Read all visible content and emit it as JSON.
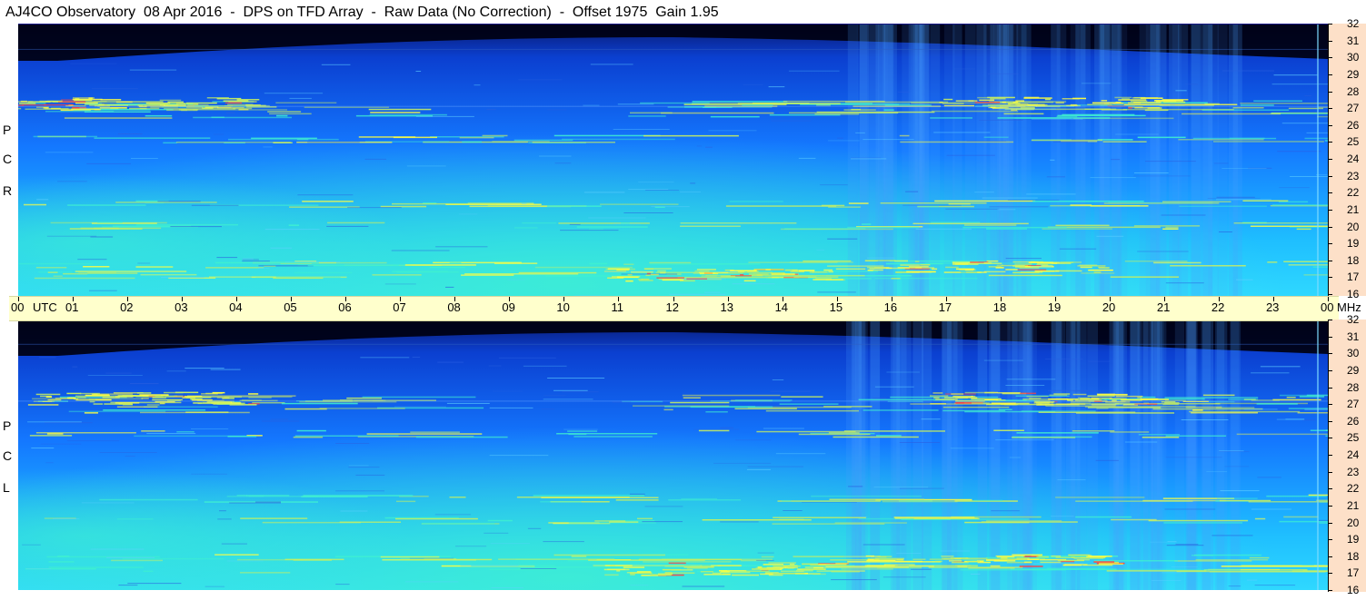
{
  "title": "AJ4CO Observatory  08 Apr 2016  -  DPS on TFD Array  -  Raw Data (No Correction)  -  Offset 1975  Gain 1.95",
  "chart_data": {
    "type": "heatmap",
    "x_axis": {
      "unit": "UTC",
      "range": [
        0,
        24
      ],
      "tick_labels": [
        "00",
        "01",
        "02",
        "03",
        "04",
        "05",
        "06",
        "07",
        "08",
        "09",
        "10",
        "11",
        "12",
        "13",
        "14",
        "15",
        "16",
        "17",
        "18",
        "19",
        "20",
        "21",
        "22",
        "23",
        "00"
      ]
    },
    "y_axis": {
      "unit": "MHz",
      "range": [
        16,
        32
      ],
      "tick_labels": [
        "32",
        "31",
        "30",
        "29",
        "28",
        "27",
        "26",
        "25",
        "24",
        "23",
        "22",
        "21",
        "20",
        "19",
        "18",
        "17",
        "16"
      ]
    },
    "panels": [
      {
        "label_letters": [
          "P",
          "C",
          "R"
        ]
      },
      {
        "label_letters": [
          "P",
          "C",
          "L"
        ]
      }
    ],
    "colormap": [
      "#000000",
      "#0a1a70",
      "#0b3fd0",
      "#1478ff",
      "#1fbfff",
      "#3ff0d0",
      "#c8f060",
      "#ffff40",
      "#ff4040"
    ]
  }
}
